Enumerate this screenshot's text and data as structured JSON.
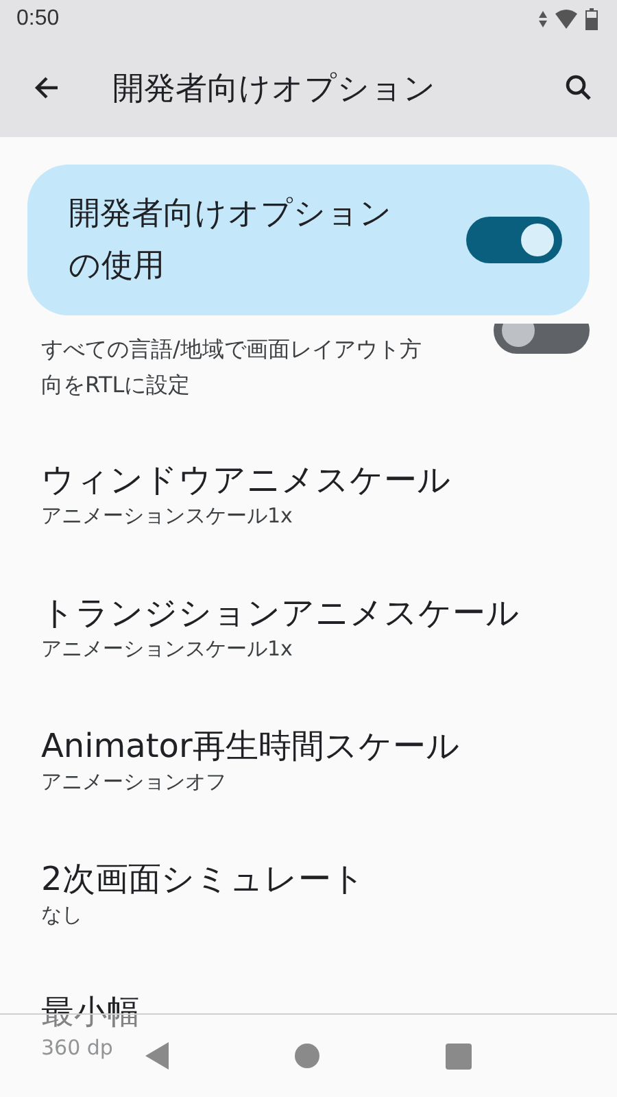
{
  "status_bar": {
    "time": "0:50"
  },
  "toolbar": {
    "title": "開発者向けオプション"
  },
  "main_switch": {
    "label": "開発者向けオプションの使用",
    "on": true
  },
  "settings": [
    {
      "summary": "すべての言語/地域で画面レイアウト方向をRTLに設定",
      "kind": "switch",
      "on": false
    },
    {
      "title": "ウィンドウアニメスケール",
      "summary": "アニメーションスケール1x",
      "kind": "text"
    },
    {
      "title": "トランジションアニメスケール",
      "summary": "アニメーションスケール1x",
      "kind": "text"
    },
    {
      "title": "Animator再生時間スケール",
      "summary": "アニメーションオフ",
      "kind": "text"
    },
    {
      "title": "2次画面シミュレート",
      "summary": "なし",
      "kind": "text"
    },
    {
      "title": "最小幅",
      "summary": "360 dp",
      "kind": "text"
    }
  ]
}
